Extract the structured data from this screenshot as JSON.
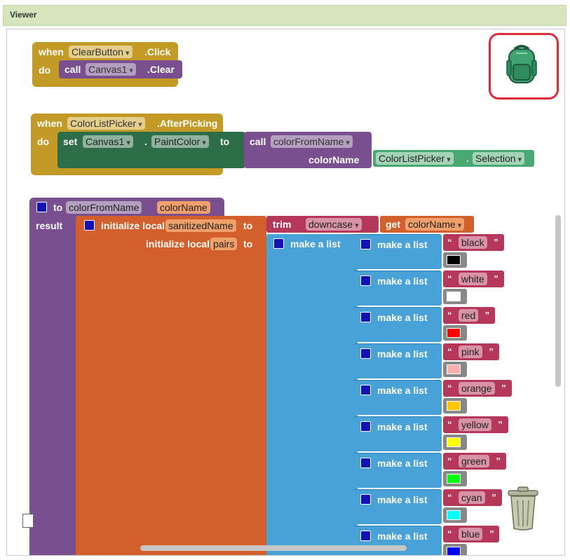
{
  "viewer": {
    "title": "Viewer"
  },
  "block1": {
    "when": "when",
    "component": "ClearButton",
    "event": ".Click",
    "do": "do",
    "call": "call",
    "target": "Canvas1",
    "method": ".Clear"
  },
  "block2": {
    "when": "when",
    "component": "ColorListPicker",
    "event": ".AfterPicking",
    "do": "do",
    "set": "set",
    "target": "Canvas1",
    "dot": ".",
    "property": "PaintColor",
    "to": "to",
    "call": "call",
    "procedure": "colorFromName",
    "arg_label": "colorName",
    "arg_component": "ColorListPicker",
    "arg_dot": ".",
    "arg_property": "Selection"
  },
  "block3": {
    "to": "to",
    "proc_name": "colorFromName",
    "param": "colorName",
    "result": "result",
    "init_local_1": "initialize local",
    "var1": "sanitizedName",
    "to1": "to",
    "trim": "trim",
    "downcase": "downcase",
    "get": "get",
    "get_var": "colorName",
    "init_local_2": "initialize local",
    "var2": "pairs",
    "to2": "to",
    "make_list_outer": "make a list",
    "pairs_list": [
      {
        "label": "make a list",
        "name": "black",
        "color": "#000000"
      },
      {
        "label": "make a list",
        "name": "white",
        "color": "#ffffff"
      },
      {
        "label": "make a list",
        "name": "red",
        "color": "#ff0000"
      },
      {
        "label": "make a list",
        "name": "pink",
        "color": "#ffafaf"
      },
      {
        "label": "make a list",
        "name": "orange",
        "color": "#ffc800"
      },
      {
        "label": "make a list",
        "name": "yellow",
        "color": "#ffff00"
      },
      {
        "label": "make a list",
        "name": "green",
        "color": "#00ff00"
      },
      {
        "label": "make a list",
        "name": "cyan",
        "color": "#00ffff"
      },
      {
        "label": "make a list",
        "name": "blue",
        "color": "#0000ff"
      }
    ]
  },
  "quote_open": "“",
  "quote_close": "”",
  "icons": {
    "backpack": "backpack-icon",
    "trash": "trash-can-icon"
  },
  "colors": {
    "event_block": "#c49a26",
    "procedure_block": "#7a4f8f",
    "set_block": "#2d6e48",
    "variable_block": "#d35f2c",
    "list_block": "#48a1d7",
    "text_block": "#b5375a",
    "component_getter": "#4aa873",
    "highlight_frame": "#e02a3a"
  }
}
